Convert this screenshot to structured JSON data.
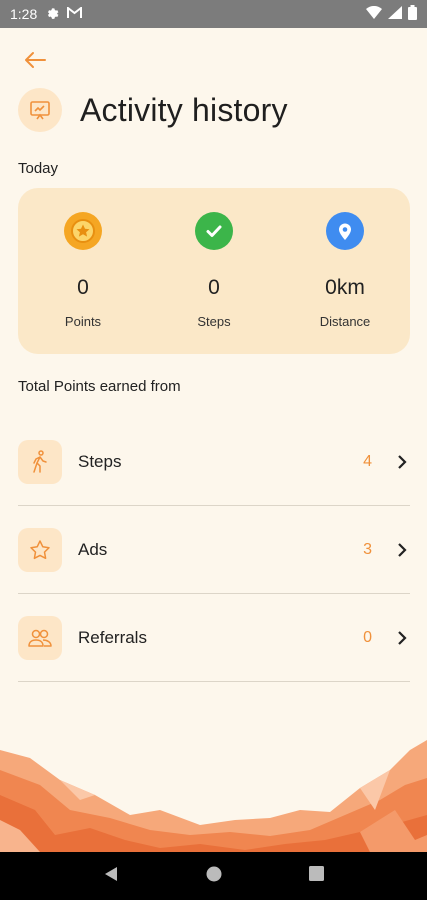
{
  "status_bar": {
    "time": "1:28"
  },
  "header": {
    "title": "Activity history"
  },
  "today": {
    "label": "Today",
    "stats": [
      {
        "value": "0",
        "label": "Points",
        "icon": "star-icon",
        "color": "#f5a623"
      },
      {
        "value": "0",
        "label": "Steps",
        "icon": "check-icon",
        "color": "#3cb54a"
      },
      {
        "value": "0km",
        "label": "Distance",
        "icon": "location-pin-icon",
        "color": "#3f8cf0"
      }
    ]
  },
  "points": {
    "label": "Total Points earned from",
    "items": [
      {
        "label": "Steps",
        "value": "4",
        "icon": "walking-icon"
      },
      {
        "label": "Ads",
        "value": "3",
        "icon": "star-outline-icon"
      },
      {
        "label": "Referrals",
        "value": "0",
        "icon": "people-icon"
      }
    ]
  },
  "colors": {
    "accent": "#f0913b",
    "background": "#fdf7ec",
    "card": "#fbe8c8",
    "icon_bg": "#fde6c7"
  }
}
